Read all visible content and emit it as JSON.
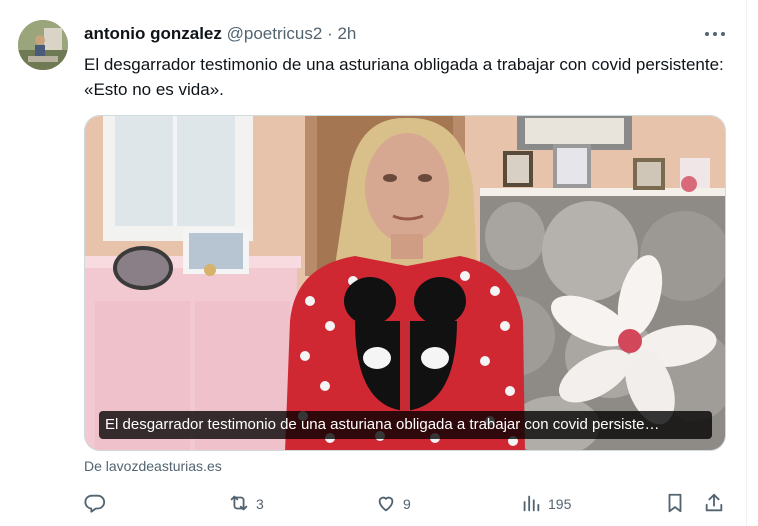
{
  "tweet": {
    "author_name": "antonio gonzalez",
    "handle": "@poetricus2",
    "separator": "·",
    "time": "2h",
    "text": "El desgarrador testimonio de una asturiana obligada a trabajar con covid persistente: «Esto no es vida».",
    "more_icon": "more-horizontal-icon"
  },
  "media": {
    "caption": "El desgarrador testimonio de una asturiana obligada a trabajar con covid persiste…",
    "source": "De lavozdeasturias.es"
  },
  "actions": {
    "reply": {
      "icon": "reply-icon",
      "count": ""
    },
    "retweet": {
      "icon": "retweet-icon",
      "count": "3"
    },
    "like": {
      "icon": "heart-icon",
      "count": "9"
    },
    "views": {
      "icon": "views-chart-icon",
      "count": "195"
    },
    "bookmark": {
      "icon": "bookmark-icon"
    },
    "share": {
      "icon": "share-icon"
    }
  },
  "colors": {
    "text_primary": "#0f1419",
    "text_secondary": "#536471",
    "border": "#cfd9de"
  }
}
